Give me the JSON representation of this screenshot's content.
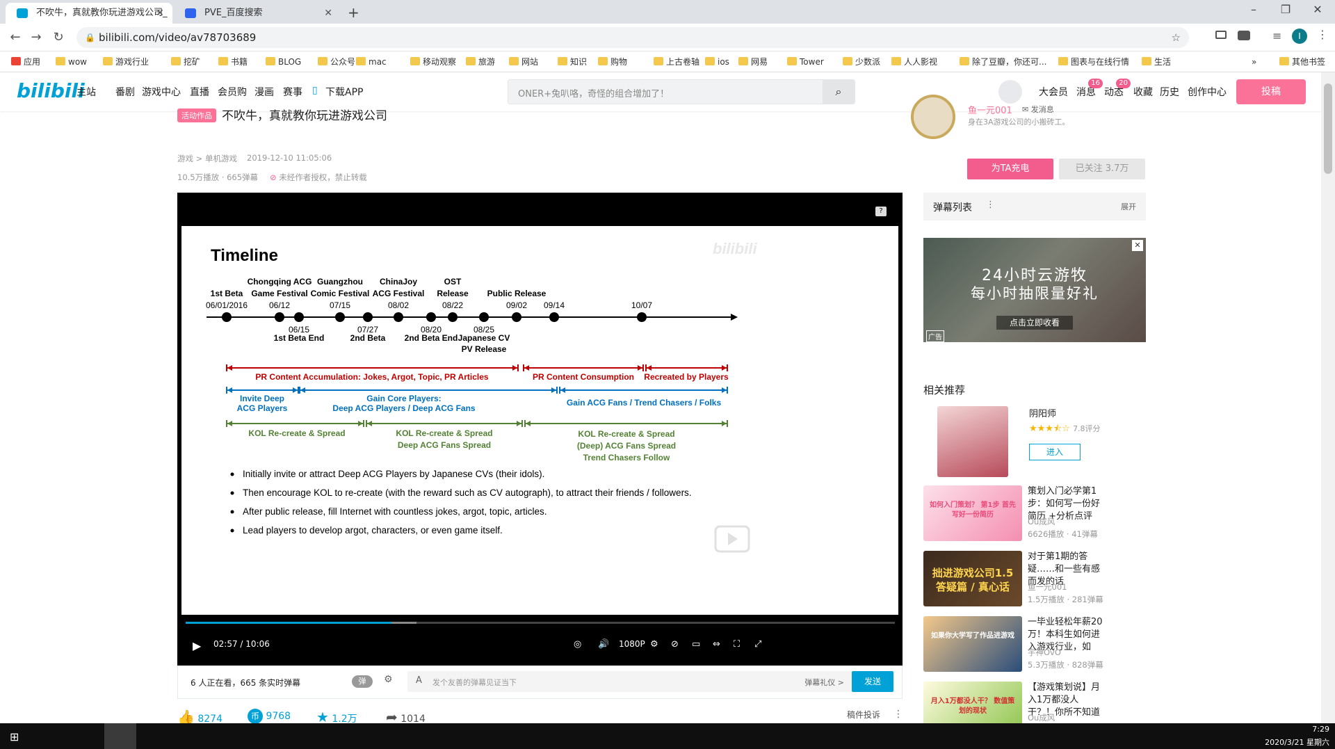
{
  "browser": {
    "tabs": [
      {
        "label": "不吹牛，真就教你玩进游戏公司_",
        "active": true
      },
      {
        "label": "PVE_百度搜索",
        "active": false
      }
    ],
    "url": "bilibili.com/video/av78703689",
    "bookmarks": [
      "应用",
      "wow",
      "游戏行业",
      "挖矿",
      "书籍",
      "BLOG",
      "公众号",
      "mac",
      "移动观察",
      "旅游",
      "网站",
      "知识",
      "购物",
      "上古卷轴",
      "ios",
      "网易",
      "Tower",
      "少数派",
      "人人影视",
      "除了豆瓣，你还可...",
      "图表与在线行情",
      "生活",
      "其他书签"
    ],
    "more": "»"
  },
  "nav": {
    "logo": "bilibili",
    "links": [
      "主站",
      "番剧",
      "游戏中心",
      "直播",
      "会员购",
      "漫画",
      "赛事",
      "下载APP"
    ],
    "search_placeholder": "ONER+兔叭咯，奇怪的组合增加了！",
    "right_links": [
      "大会员",
      "消息",
      "动态",
      "收藏",
      "历史",
      "创作中心"
    ],
    "message_count": "16",
    "dynamic_count": "20",
    "upload": "投稿"
  },
  "video": {
    "tag": "活动作品",
    "title": "不吹牛，真就教你玩进游戏公司",
    "breadcrumb": "游戏 > 单机游戏",
    "date": "2019-12-10 11:05:06",
    "stats": "10.5万播放 · 665弹幕",
    "copyright": "未经作者授权，禁止转载"
  },
  "slide": {
    "title": "Timeline",
    "watermark": "bilibili",
    "events_top": [
      {
        "l1": "",
        "l2": "1st Beta",
        "l3": "06/01/2016"
      },
      {
        "l1": "Chongqing ACG",
        "l2": "Game Festival",
        "l3": "06/12"
      },
      {
        "l1": "Guangzhou",
        "l2": "Comic Festival",
        "l3": "07/15"
      },
      {
        "l1": "ChinaJoy",
        "l2": "ACG Festival",
        "l3": "08/02"
      },
      {
        "l1": "OST",
        "l2": "Release",
        "l3": "08/22"
      },
      {
        "l1": "",
        "l2": "Public Release",
        "l3": "09/02"
      },
      {
        "l1": "",
        "l2": "",
        "l3": "09/14"
      },
      {
        "l1": "",
        "l2": "",
        "l3": "10/07"
      }
    ],
    "events_bottom": [
      {
        "l1": "06/15",
        "l2": "1st Beta End"
      },
      {
        "l1": "07/27",
        "l2": "2nd Beta"
      },
      {
        "l1": "08/20",
        "l2": "2nd Beta End"
      },
      {
        "l1": "08/25",
        "l2": "Japanese CV",
        "l3": "PV Release"
      }
    ],
    "red_ranges": [
      "PR Content Accumulation: Jokes, Argot, Topic, PR Articles",
      "PR Content Consumption",
      "Recreated by Players"
    ],
    "blue_ranges": [
      {
        "l1": "Invite Deep",
        "l2": "ACG Players"
      },
      {
        "l1": "Gain Core Players:",
        "l2": "Deep ACG Players / Deep ACG Fans"
      },
      {
        "l1": "Gain ACG Fans / Trend Chasers / Folks",
        "l2": ""
      }
    ],
    "green_ranges": [
      {
        "l1": "KOL Re-create & Spread",
        "l2": "",
        "l3": ""
      },
      {
        "l1": "KOL Re-create & Spread",
        "l2": "Deep ACG Fans Spread",
        "l3": ""
      },
      {
        "l1": "KOL Re-create & Spread",
        "l2": "(Deep) ACG Fans Spread",
        "l3": "Trend Chasers Follow"
      }
    ],
    "bullets": [
      "Initially invite or attract Deep ACG Players by Japanese CVs (their idols).",
      "Then encourage KOL to re-create (with the reward such as CV autograph), to attract their friends / followers.",
      "After public release, fill Internet with countless jokes, argot, topic, articles.",
      "Lead players to develop argot, characters, or even game itself."
    ]
  },
  "player": {
    "time": "02:57 / 10:06",
    "quality": "1080P",
    "progress": 0.29,
    "buffered": 0.325
  },
  "danmu_bar": {
    "viewers": "6 人正在看，665 条实时弹幕",
    "toggle": "弹",
    "placeholder": "发个友善的弹幕见证当下",
    "etiquette": "弹幕礼仪 >",
    "send": "发送"
  },
  "actions": {
    "like": "8274",
    "coin": "9768",
    "fav": "1.2万",
    "share": "1014",
    "report": "稿件投诉"
  },
  "uploader": {
    "name": "鱼一元001",
    "message": "发消息",
    "bio": "身在3A游戏公司的小搬砖工。",
    "charge": "为TA充电",
    "follow": "已关注 3.7万"
  },
  "danmaku_list": {
    "title": "弹幕列表",
    "expand": "展开"
  },
  "ad": {
    "line1": "24小时云游牧",
    "line2": "每小时抽限量好礼",
    "cta": "点击立即收看",
    "tag": "广告"
  },
  "related": {
    "title": "相关推荐",
    "game": {
      "name": "阴阳师",
      "rating": "7.8评分",
      "enter": "进入"
    },
    "items": [
      {
        "title": "策划入门必学第1步：如何写一份好简历 +分析点评",
        "up": "Ou成风",
        "stats": "6626播放 · 41弹幕",
        "thumb_text": "如何入门策划？ 第1步 首先写好一份简历"
      },
      {
        "title": "对于第1期的答疑……和一些有感而发的话",
        "up": "鱼一元001",
        "stats": "1.5万播放 · 281弹幕",
        "thumb_text": "拙进游戏公司1.5 答疑篇 / 真心话"
      },
      {
        "title": "一毕业轻松年薪20万！本科生如何进入游戏行业，如",
        "up": "宇神OvO",
        "stats": "5.3万播放 · 828弹幕",
        "thumb_text": "如果你大学写了作品进游戏"
      },
      {
        "title": "【游戏策划说】月入1万都没人干？！你所不知道",
        "up": "Ou成风",
        "stats": "",
        "thumb_text": "月入1万都没人干？ 数值策划的现状"
      }
    ]
  },
  "taskbar": {
    "time": "7:29",
    "date": "2020/3/21 星期六"
  },
  "colors": {
    "pink": "#fb7299",
    "blue": "#00a1d6",
    "red": "#c00000",
    "slide_blue": "#0070c0",
    "green": "#548235"
  }
}
